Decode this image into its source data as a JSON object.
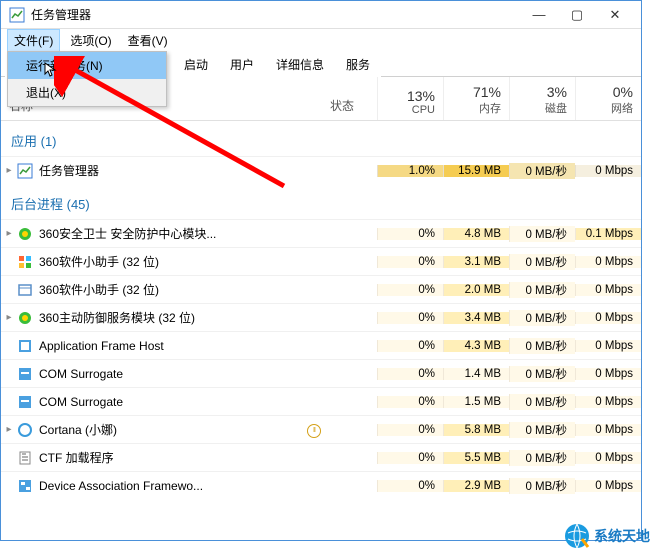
{
  "window": {
    "title": "任务管理器"
  },
  "window_controls": {
    "min": "—",
    "max": "▢",
    "close": "✕"
  },
  "menubar": {
    "file": "文件(F)",
    "options": "选项(O)",
    "view": "查看(V)"
  },
  "file_menu": {
    "run_new_task": "运行新任务(N)",
    "exit": "退出(X)"
  },
  "tabs": {
    "startup": "启动",
    "users": "用户",
    "details": "详细信息",
    "services": "服务"
  },
  "columns": {
    "name": "名称",
    "status": "状态",
    "cpu_pct": "13%",
    "cpu_label": "CPU",
    "mem_pct": "71%",
    "mem_label": "内存",
    "disk_pct": "3%",
    "disk_label": "磁盘",
    "net_pct": "0%",
    "net_label": "网络"
  },
  "groups": {
    "apps": "应用 (1)",
    "background": "后台进程 (45)"
  },
  "processes": {
    "task_manager": {
      "name": "任务管理器",
      "cpu": "1.0%",
      "mem": "15.9 MB",
      "disk": "0 MB/秒",
      "net": "0 Mbps"
    },
    "p360_guard": {
      "name": "360安全卫士 安全防护中心模块...",
      "cpu": "0%",
      "mem": "4.8 MB",
      "disk": "0 MB/秒",
      "net": "0.1 Mbps"
    },
    "p360_soft1": {
      "name": "360软件小助手 (32 位)",
      "cpu": "0%",
      "mem": "3.1 MB",
      "disk": "0 MB/秒",
      "net": "0 Mbps"
    },
    "p360_soft2": {
      "name": "360软件小助手 (32 位)",
      "cpu": "0%",
      "mem": "2.0 MB",
      "disk": "0 MB/秒",
      "net": "0 Mbps"
    },
    "p360_defense": {
      "name": "360主动防御服务模块 (32 位)",
      "cpu": "0%",
      "mem": "3.4 MB",
      "disk": "0 MB/秒",
      "net": "0 Mbps"
    },
    "app_frame": {
      "name": "Application Frame Host",
      "cpu": "0%",
      "mem": "4.3 MB",
      "disk": "0 MB/秒",
      "net": "0 Mbps"
    },
    "com1": {
      "name": "COM Surrogate",
      "cpu": "0%",
      "mem": "1.4 MB",
      "disk": "0 MB/秒",
      "net": "0 Mbps"
    },
    "com2": {
      "name": "COM Surrogate",
      "cpu": "0%",
      "mem": "1.5 MB",
      "disk": "0 MB/秒",
      "net": "0 Mbps"
    },
    "cortana": {
      "name": "Cortana (小娜)",
      "cpu": "0%",
      "mem": "5.8 MB",
      "disk": "0 MB/秒",
      "net": "0 Mbps"
    },
    "ctf": {
      "name": "CTF 加载程序",
      "cpu": "0%",
      "mem": "5.5 MB",
      "disk": "0 MB/秒",
      "net": "0 Mbps"
    },
    "dev_assoc": {
      "name": "Device Association Framewo...",
      "cpu": "0%",
      "mem": "2.9 MB",
      "disk": "0 MB/秒",
      "net": "0 Mbps"
    }
  },
  "watermark": {
    "text": "系统天地"
  }
}
